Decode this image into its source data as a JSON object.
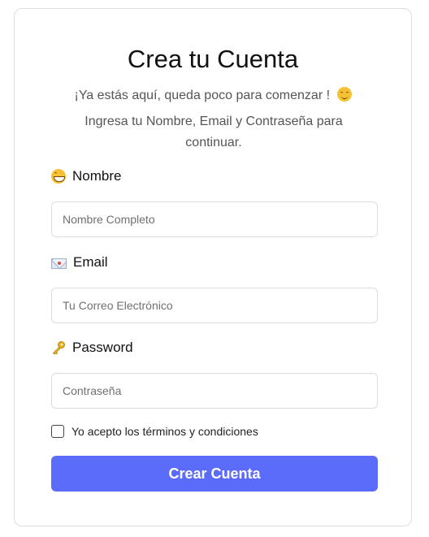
{
  "form": {
    "title": "Crea tu Cuenta",
    "subtitle": "¡Ya estás aquí, queda poco para comenzar !",
    "subtitle_emoji": "smiling-face-icon",
    "instruction": "Ingresa tu Nombre, Email y Contraseña para continuar."
  },
  "fields": {
    "name": {
      "icon": "grinning-face-icon",
      "label": "Nombre",
      "placeholder": "Nombre Completo",
      "value": ""
    },
    "email": {
      "icon": "envelope-icon",
      "label": "Email",
      "placeholder": "Tu Correo Electrónico",
      "value": ""
    },
    "password": {
      "icon": "key-icon",
      "label": "Password",
      "placeholder": "Contraseña",
      "value": ""
    }
  },
  "terms": {
    "label": "Yo acepto los términos y condiciones",
    "checked": false
  },
  "submit": {
    "label": "Crear Cuenta"
  },
  "colors": {
    "accent": "#5c6cfa",
    "border": "#dcdcdc",
    "muted_text": "#555555"
  }
}
